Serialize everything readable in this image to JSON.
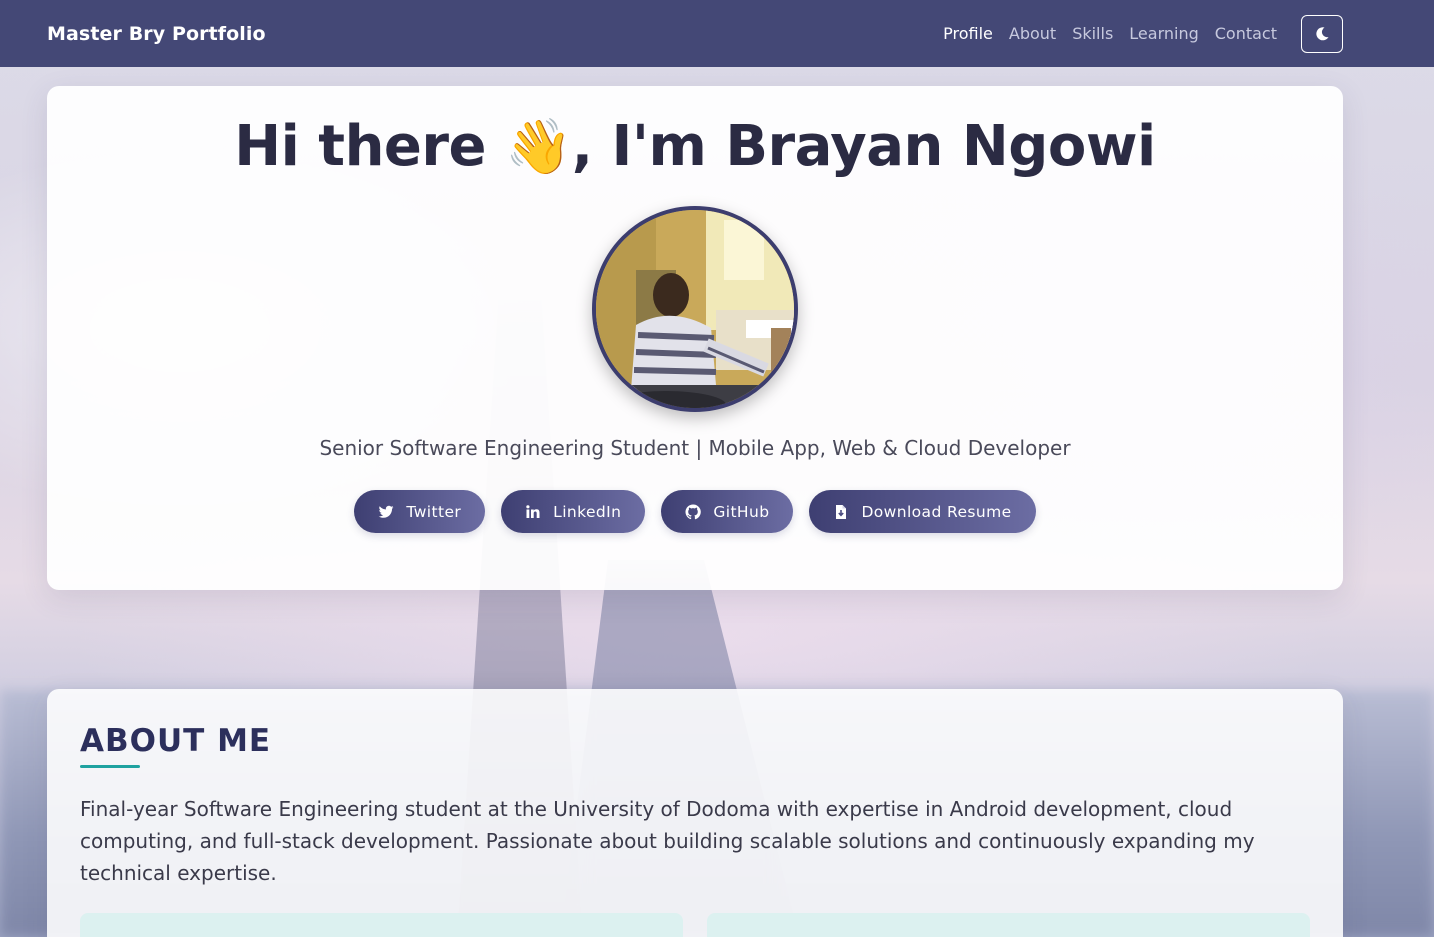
{
  "navbar": {
    "brand": "Master Bry Portfolio",
    "links": [
      {
        "label": "Profile",
        "active": true
      },
      {
        "label": "About",
        "active": false
      },
      {
        "label": "Skills",
        "active": false
      },
      {
        "label": "Learning",
        "active": false
      },
      {
        "label": "Contact",
        "active": false
      }
    ],
    "theme_toggle_icon": "moon-icon"
  },
  "hero": {
    "greeting": "Hi there",
    "wave_emoji": "👋",
    "name_text": ", I'm Brayan Ngowi",
    "avatar_alt": "profile-photo",
    "tagline": "Senior Software Engineering Student | Mobile App, Web & Cloud Developer",
    "buttons": [
      {
        "label": "Twitter",
        "icon": "twitter-icon"
      },
      {
        "label": "LinkedIn",
        "icon": "linkedin-icon"
      },
      {
        "label": "GitHub",
        "icon": "github-icon"
      },
      {
        "label": "Download Resume",
        "icon": "file-download-icon"
      }
    ]
  },
  "about": {
    "heading": "ABOUT ME",
    "body": "Final-year Software Engineering student at the University of Dodoma with expertise in Android development, cloud computing, and full-stack development. Passionate about building scalable solutions and continuously expanding my technical expertise."
  },
  "colors": {
    "navbar": "#444876",
    "title": "#2b2b43",
    "button_start": "#3e3f72",
    "button_end": "#6c6da3",
    "accent_underline": "#1fa2a0",
    "about_heading": "#2c2f5c"
  }
}
